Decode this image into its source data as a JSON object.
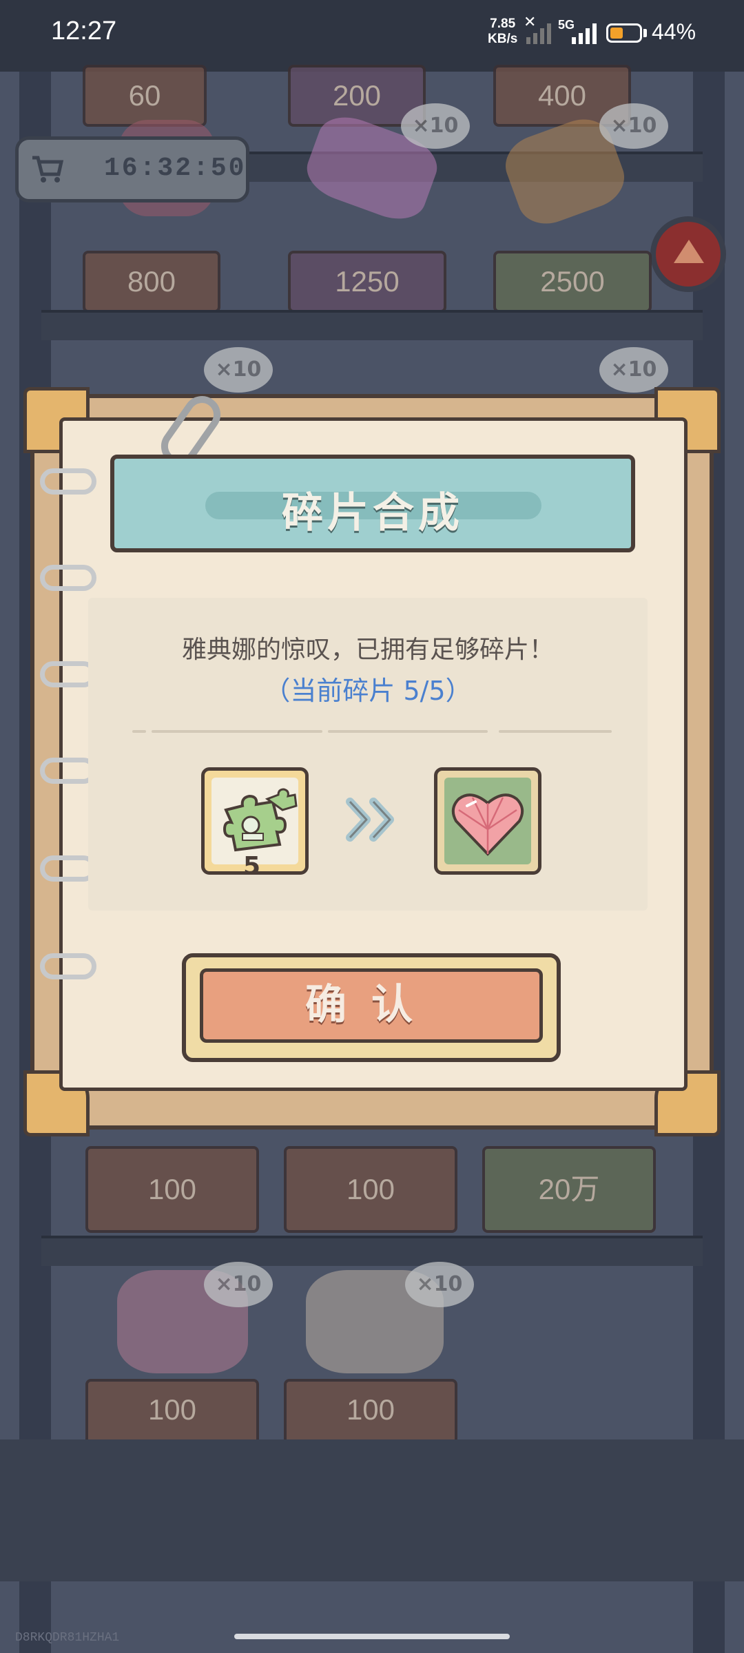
{
  "status_bar": {
    "time": "12:27",
    "net_speed_value": "7.85",
    "net_speed_unit": "KB/s",
    "network": "5G",
    "battery_percent": "44%",
    "battery_level": 0.44
  },
  "scene": {
    "top_prices": [
      "60",
      "200",
      "400"
    ],
    "timer": "16:32:50",
    "row2_prices": [
      "800",
      "1250",
      "2500"
    ],
    "bubble_label": "×10",
    "row4_prices": [
      "100",
      "100",
      "20万"
    ],
    "row5_prices": [
      "100",
      "100"
    ],
    "watermark": "D8RKQDR81HZHA1"
  },
  "dialog": {
    "title": "碎片合成",
    "message": "雅典娜的惊叹，已拥有足够碎片！",
    "fragment_status": "（当前碎片  5/5）",
    "source_item_count": "5",
    "arrow": "»",
    "confirm_label": "确认",
    "source_icon": "puzzle-piece-icon",
    "result_icon": "heart-gem-icon"
  },
  "colors": {
    "banner": "#9fcfcf",
    "status_text": "#4a80cf",
    "confirm": "#e8a07f",
    "battery": "#f3a12a"
  }
}
